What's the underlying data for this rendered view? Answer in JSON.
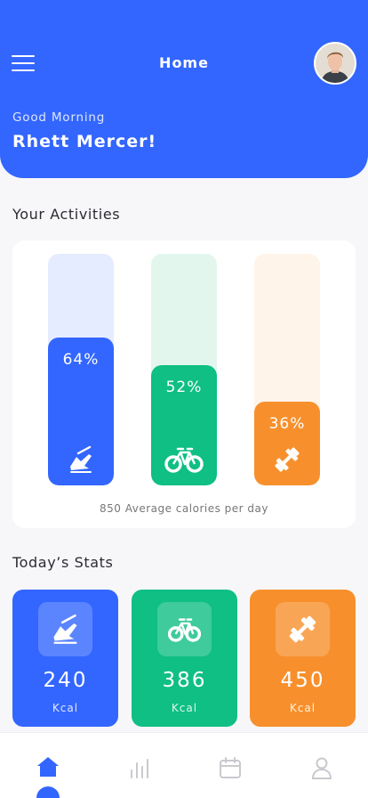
{
  "header": {
    "title": "Home",
    "greeting": "Good Morning",
    "user_name": "Rhett Mercer!",
    "accent_color": "#3366ff",
    "avatar_icon": "user-avatar"
  },
  "activities": {
    "section_title": "Your Activities",
    "caption": "850 Average calories per day",
    "bars": [
      {
        "percent_label": "64%",
        "percent": 64,
        "icon": "running-shoe-icon",
        "color": "#3366ff",
        "track_color": "#e6ecff"
      },
      {
        "percent_label": "52%",
        "percent": 52,
        "icon": "bicycle-icon",
        "color": "#0fbf83",
        "track_color": "#e2f6ee"
      },
      {
        "percent_label": "36%",
        "percent": 36,
        "icon": "dumbbell-icon",
        "color": "#f7902c",
        "track_color": "#fff4ea"
      }
    ]
  },
  "stats": {
    "section_title": "Today’s Stats",
    "cards": [
      {
        "value": "240",
        "unit": "Kcal",
        "icon": "running-shoe-icon",
        "color": "#3366ff"
      },
      {
        "value": "386",
        "unit": "Kcal",
        "icon": "bicycle-icon",
        "color": "#0fbf83"
      },
      {
        "value": "450",
        "unit": "Kcal",
        "icon": "dumbbell-icon",
        "color": "#f7902c"
      }
    ]
  },
  "tabbar": {
    "tabs": [
      {
        "icon": "home-icon",
        "active": true
      },
      {
        "icon": "bar-chart-icon",
        "active": false
      },
      {
        "icon": "calendar-icon",
        "active": false
      },
      {
        "icon": "profile-icon",
        "active": false
      }
    ]
  }
}
